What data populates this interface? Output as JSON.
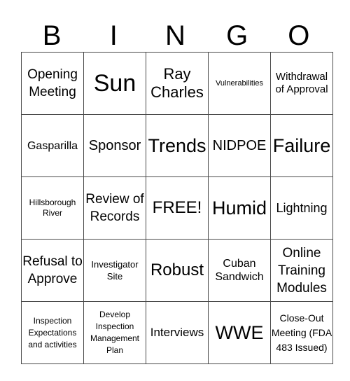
{
  "header": {
    "letters": [
      "B",
      "I",
      "N",
      "G",
      "O"
    ]
  },
  "card": {
    "rows": [
      [
        "Opening Meeting",
        "Sun",
        "Ray Charles",
        "Vulnerabilities",
        "Withdrawal of Approval"
      ],
      [
        "Gasparilla",
        "Sponsor",
        "Trends",
        "NIDPOE",
        "Failure"
      ],
      [
        "Hillsborough River",
        "Review of Records",
        "FREE!",
        "Humid",
        "Lightning"
      ],
      [
        "Refusal to Approve",
        "Investigator Site",
        "Robust",
        "Cuban Sandwich",
        "Online Training Modules"
      ],
      [
        "Inspection Expectations and activities",
        "Develop Inspection Management Plan",
        "Interviews",
        "WWE",
        "Close-Out Meeting (FDA 483 Issued)"
      ]
    ]
  }
}
